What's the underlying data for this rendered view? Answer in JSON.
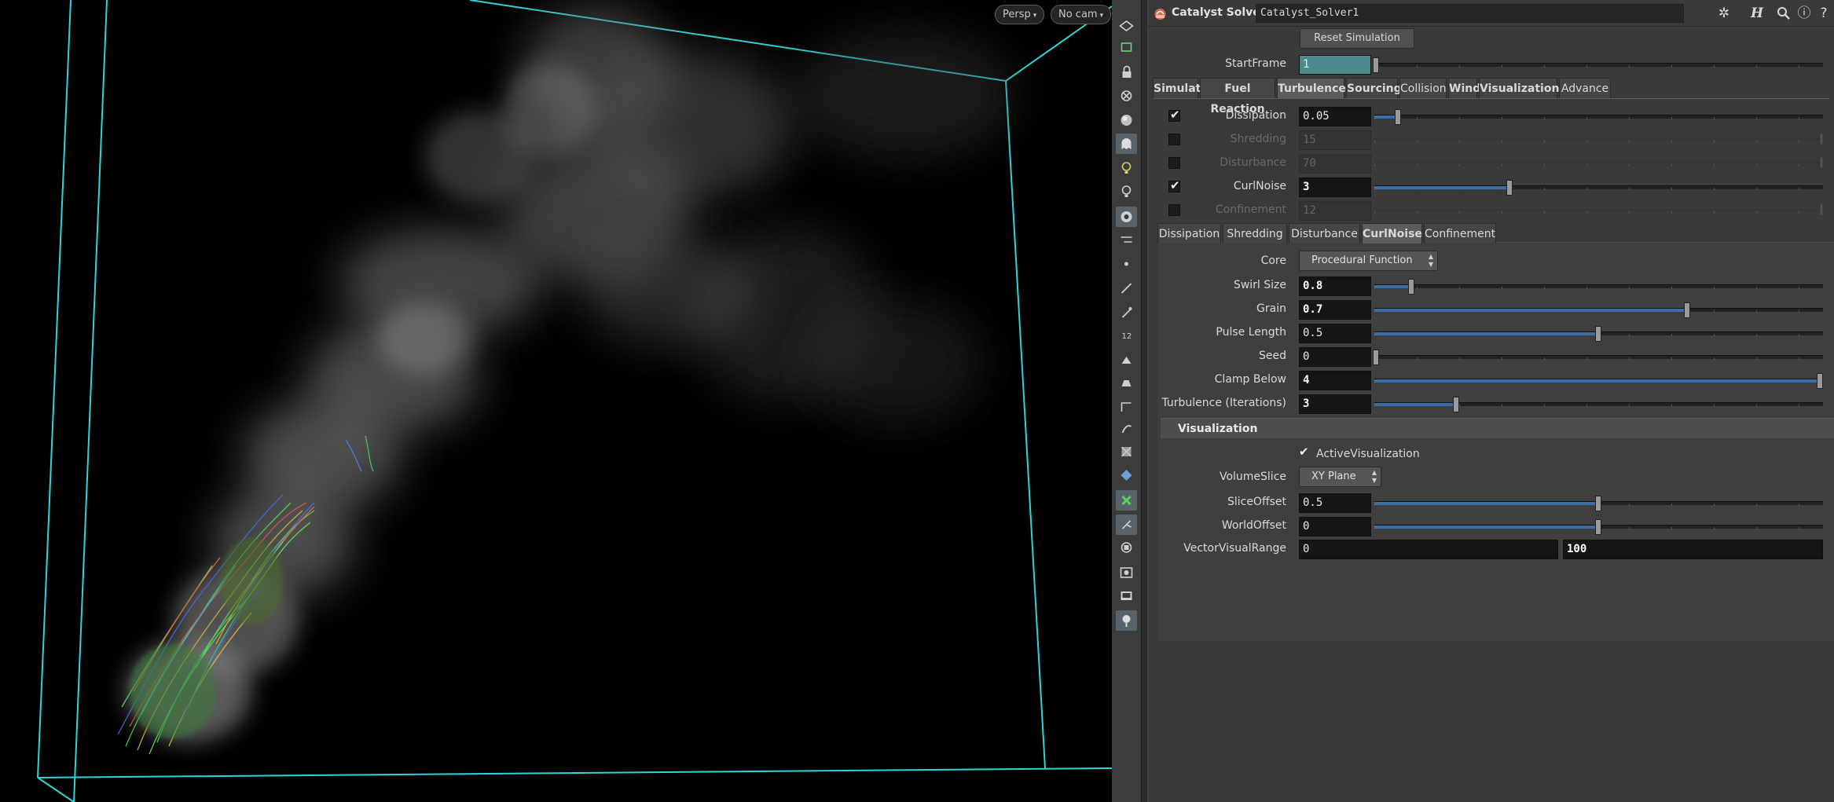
{
  "viewport": {
    "persp_label": "Persp",
    "cam_label": "No cam"
  },
  "toolbar": {
    "icons": [
      "select-icon",
      "view-icon",
      "lock-icon",
      "clear-icon",
      "sphere-display-icon",
      "ghost-icon",
      "light-icon",
      "light-alt-icon",
      "camera-icon",
      "handle-icon",
      "dot-icon",
      "edge-icon",
      "pick-icon",
      "number-icon",
      "snap-icon",
      "tool-icon",
      "grid-icon",
      "flip-icon",
      "texture-icon",
      "wire-icon",
      "render-icon",
      "particle-icon",
      "axis-icon",
      "record-icon",
      "screen-icon",
      "pin-icon"
    ]
  },
  "header": {
    "node_type": "Catalyst Solver",
    "node_name": "Catalyst_Solver1"
  },
  "params": {
    "reset_label": "Reset Simulation",
    "startframe_label": "StartFrame",
    "startframe_value": "1"
  },
  "main_tabs": [
    {
      "label": "Simulation"
    },
    {
      "label": "Fuel Reaction"
    },
    {
      "label": "Turbulence"
    },
    {
      "label": "Sourcing"
    },
    {
      "label": "Collision"
    },
    {
      "label": "Wind"
    },
    {
      "label": "Visualization"
    },
    {
      "label": "Advance"
    }
  ],
  "turbulence": [
    {
      "label": "Dissipation",
      "value": "0.05",
      "checked": true,
      "enabled": true,
      "level": 0.05
    },
    {
      "label": "Shredding",
      "value": "15",
      "checked": false,
      "enabled": false,
      "level": 1.0
    },
    {
      "label": "Disturbance",
      "value": "70",
      "checked": false,
      "enabled": false,
      "level": 1.0
    },
    {
      "label": "CurlNoise",
      "value": "3",
      "checked": true,
      "enabled": true,
      "level": 0.3
    },
    {
      "label": "Confinement",
      "value": "12",
      "checked": false,
      "enabled": false,
      "level": 1.0
    }
  ],
  "sub_tabs": [
    {
      "label": "Dissipation"
    },
    {
      "label": "Shredding"
    },
    {
      "label": "Disturbance"
    },
    {
      "label": "CurlNoise"
    },
    {
      "label": "Confinement"
    }
  ],
  "curlnoise": {
    "core_label": "Core",
    "core_value": "Procedural Function",
    "rows": [
      {
        "label": "Swirl Size",
        "value": "0.8",
        "level": 0.08
      },
      {
        "label": "Grain",
        "value": "0.7",
        "level": 0.7
      },
      {
        "label": "Pulse Length",
        "value": "0.5",
        "level": 0.5
      },
      {
        "label": "Seed",
        "value": "0",
        "level": 0.0
      },
      {
        "label": "Clamp Below",
        "value": "4",
        "level": 1.0
      },
      {
        "label": "Turbulence (Iterations)",
        "value": "3",
        "level": 0.18
      }
    ]
  },
  "visualization": {
    "folder_label": "Visualization",
    "active_label": "ActiveVisualization",
    "active_checked": true,
    "volumeslice_label": "VolumeSlice",
    "volumeslice_value": "XY Plane",
    "sliceoffset_label": "SliceOffset",
    "sliceoffset_value": "0.5",
    "sliceoffset_level": 0.5,
    "worldoffset_label": "WorldOffset",
    "worldoffset_value": "0",
    "worldoffset_level": 0.5,
    "vectorrange_label": "VectorVisualRange",
    "vectorrange_min": "0",
    "vectorrange_max": "100"
  },
  "colors": {
    "bbox": "#2fd5d8",
    "accent": "#3d6ea8",
    "startframe": "#4d8a8c"
  }
}
